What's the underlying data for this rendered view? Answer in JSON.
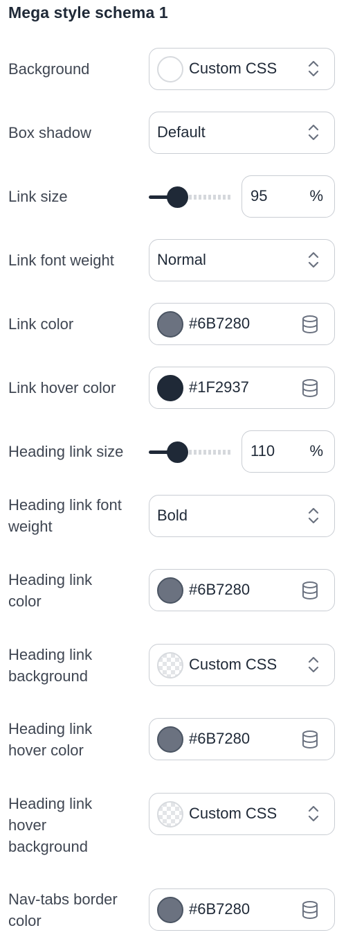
{
  "panel": {
    "title": "Mega style schema 1"
  },
  "fields": {
    "background": {
      "label": "Background",
      "value": "Custom CSS",
      "swatch": "#ffffff"
    },
    "box_shadow": {
      "label": "Box shadow",
      "value": "Default"
    },
    "link_size": {
      "label": "Link size",
      "value": "95",
      "unit": "%"
    },
    "link_font_weight": {
      "label": "Link font weight",
      "value": "Normal"
    },
    "link_color": {
      "label": "Link color",
      "value": "#6B7280",
      "swatch": "#6B7280"
    },
    "link_hover_color": {
      "label": "Link hover color",
      "value": "#1F2937",
      "swatch": "#1F2937"
    },
    "heading_link_size": {
      "label": "Heading link size",
      "value": "110",
      "unit": "%"
    },
    "heading_link_font_weight": {
      "label_line1": "Heading link font",
      "label_line2": "weight",
      "value": "Bold"
    },
    "heading_link_color": {
      "label_line1": "Heading link",
      "label_line2": "color",
      "value": "#6B7280",
      "swatch": "#6B7280"
    },
    "heading_link_background": {
      "label_line1": "Heading link",
      "label_line2": "background",
      "value": "Custom CSS"
    },
    "heading_link_hover_color": {
      "label_line1": "Heading link",
      "label_line2": "hover color",
      "value": "#6B7280",
      "swatch": "#6B7280"
    },
    "heading_link_hover_background": {
      "label_line1": "Heading link",
      "label_line2": "hover",
      "label_line3": "background",
      "value": "Custom CSS"
    },
    "nav_tabs_border_color": {
      "label_line1": "Nav-tabs border",
      "label_line2": "color",
      "value": "#6B7280",
      "swatch": "#6B7280"
    }
  },
  "colors": {
    "text": "#1f2937",
    "label": "#3f4652",
    "border": "#c9cdd3",
    "accent": "#1f2937"
  },
  "icons": {
    "select": "chevron-up-down-icon",
    "variable": "database-icon"
  }
}
